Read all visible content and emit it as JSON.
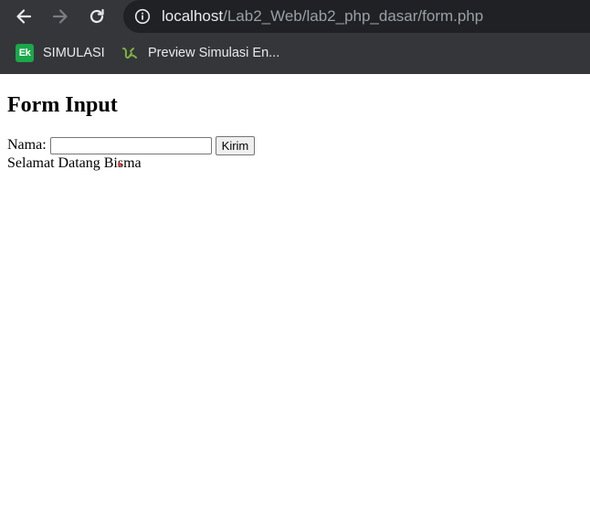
{
  "browser": {
    "url_host": "localhost",
    "url_path": "/Lab2_Web/lab2_php_dasar/form.php",
    "icons": {
      "back": "arrow-left-icon",
      "forward": "arrow-right-icon",
      "reload": "reload-icon",
      "site_info": "info-icon"
    },
    "bookmarks": [
      {
        "label": "SIMULASI",
        "icon": "ek-icon",
        "icon_text": "Ek",
        "icon_color": "#1aa84a"
      },
      {
        "label": "Preview Simulasi En...",
        "icon": "ek-swirl-icon",
        "icon_color": "#7cb342"
      }
    ]
  },
  "page": {
    "heading": "Form Input",
    "form": {
      "name_label": "Nama:",
      "name_value": "",
      "submit_label": "Kirim"
    },
    "greeting": "Selamat Datang Bisma"
  },
  "colors": {
    "chrome_bg": "#35363a",
    "omnibox_bg": "#202124",
    "cursor": "#e53935"
  }
}
